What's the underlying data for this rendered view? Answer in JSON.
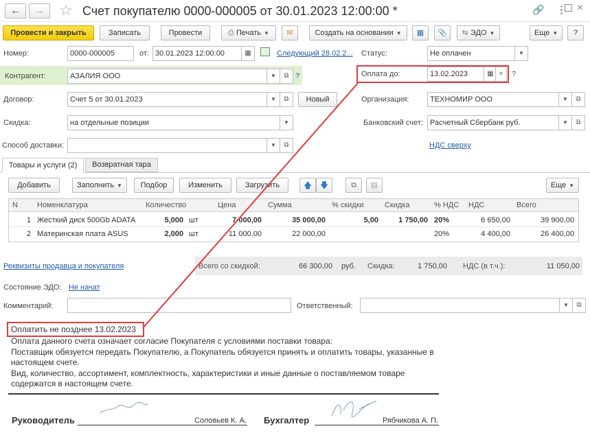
{
  "window": {
    "title": "Счет покупателю 0000-000005 от 30.01.2023 12:00:00 *"
  },
  "toolbar": {
    "post_close": "Провести и закрыть",
    "save": "Записать",
    "post": "Провести",
    "print": "Печать",
    "create_based": "Создать на основании",
    "edo": "ЭДО",
    "more": "Еще",
    "help": "?"
  },
  "form": {
    "number_label": "Номер:",
    "number_value": "0000-000005",
    "from_label": "от:",
    "date_value": "30.01.2023 12:00:00",
    "next_link": "Следующий 28.02.2...",
    "status_label": "Статус:",
    "status_value": "Не оплачен",
    "contractor_label": "Контрагент:",
    "contractor_value": "АЗАЛИЯ ООО",
    "pay_until_label": "Оплата до:",
    "pay_until_value": "13.02.2023",
    "contract_label": "Договор:",
    "contract_value": "Счет 5 от 30.01.2023",
    "new_button": "Новый",
    "org_label": "Организация:",
    "org_value": "ТЕХНОМИР ООО",
    "discount_label": "Скидка:",
    "discount_value": "на отдельные позиции",
    "bank_label": "Банковский счет:",
    "bank_value": "Расчетный Сбербанк руб.",
    "delivery_label": "Способ доставки:",
    "delivery_value": "",
    "vat_link": "НДС сверху",
    "q": "?"
  },
  "tabs": [
    "Товары и услуги (2)",
    "Возвратная тара"
  ],
  "table_toolbar": {
    "add": "Добавить",
    "fill": "Заполнить",
    "select": "Подбор",
    "change": "Изменить",
    "load": "Загрузить",
    "more": "Еще"
  },
  "table": {
    "headers": [
      "N",
      "Номенклатура",
      "Количество",
      "Цена",
      "Сумма",
      "% скидки",
      "Скидка",
      "% НДС",
      "НДС",
      "Всего"
    ],
    "rows": [
      {
        "n": "1",
        "name": "Жесткий диск 500Gb ADATA",
        "qty": "5,000",
        "unit": "шт",
        "price": "7 000,00",
        "sum": "35 000,00",
        "disc_pct": "5,00",
        "disc": "1 750,00",
        "vat_pct": "20%",
        "vat": "6 650,00",
        "total": "39 900,00"
      },
      {
        "n": "2",
        "name": "Материнская плата ASUS",
        "qty": "2,000",
        "unit": "шт",
        "price": "11 000,00",
        "sum": "22 000,00",
        "disc_pct": "",
        "disc": "",
        "vat_pct": "20%",
        "vat": "4 400,00",
        "total": "26 400,00"
      }
    ]
  },
  "totals": {
    "requisites_link": "Реквизиты продавца и покупателя",
    "total_label": "Всего со скидкой:",
    "total_value": "66 300,00",
    "currency": "руб.",
    "discount_label": "Скидка:",
    "discount_value": "1 750,00",
    "vat_label": "НДС (в т.ч.):",
    "vat_value": "11 050,00"
  },
  "edo": {
    "label": "Состояние ЭДО:",
    "value": "Не начат"
  },
  "comment": {
    "label": "Комментарий:",
    "value": "",
    "responsible_label": "Ответственный:",
    "responsible_value": ""
  },
  "footer": {
    "pay_before": "Оплатить не позднее 13.02.2023",
    "line1": "Оплата данного счета означает согласие Покупателя с условиями поставки товара:",
    "line2": "Поставщик обязуется передать Покупателю, а Покупатель обязуется принять и оплатить товары, указанные в",
    "line3": "настоящем счете.",
    "line4": "Вид, количество, ассортимент, комплектность, характеристики и иные данные о поставляемом товаре",
    "line5": "содержатся в настоящем счете.",
    "head_label": "Руководитель",
    "head_name": "Соловьев К. А.",
    "acc_label": "Бухгалтер",
    "acc_name": "Рябчикова А. П."
  },
  "colors": {
    "primary_btn": "#f5d21c",
    "highlight_box": "#e03c3c",
    "link": "#1e5aa0",
    "contractor_bg": "#dff0d0"
  }
}
